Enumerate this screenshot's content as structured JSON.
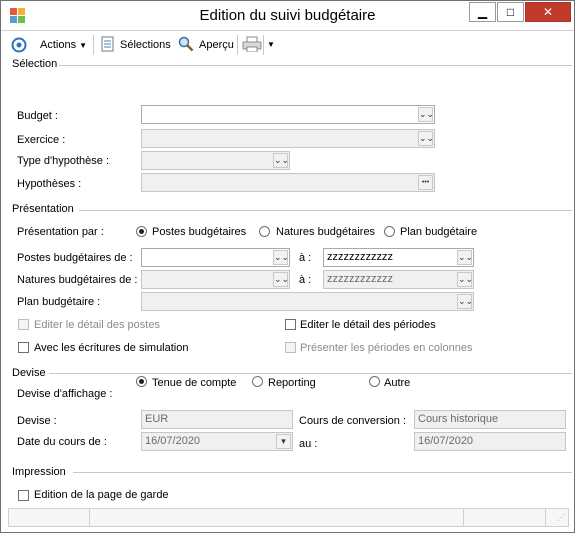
{
  "window": {
    "title": "Edition du suivi budgétaire",
    "controls": {
      "minimize": "▁",
      "maximize": "□",
      "close": "✕"
    }
  },
  "toolbar": {
    "actions_label": "Actions",
    "selections_label": "Sélections",
    "apercu_label": "Aperçu"
  },
  "selection": {
    "title": "Sélection",
    "budget": {
      "label": "Budget :",
      "value": ""
    },
    "exercice": {
      "label": "Exercice :",
      "value": ""
    },
    "type_hypothese": {
      "label": "Type d'hypothèse :",
      "value": ""
    },
    "hypotheses": {
      "label": "Hypothèses :",
      "value": "",
      "button": "•••"
    }
  },
  "presentation": {
    "title": "Présentation",
    "par_label": "Présentation par :",
    "options": [
      "Postes budgétaires",
      "Natures budgétaires",
      "Plan budgétaire"
    ],
    "selected": "Postes budgétaires",
    "postes": {
      "label": "Postes budgétaires de :",
      "from": "",
      "to_label": "à :",
      "to": "zzzzzzzzzzzz"
    },
    "natures": {
      "label": "Natures budgétaires de :",
      "from": "",
      "to_label": "à :",
      "to": "zzzzzzzzzzzz"
    },
    "plan": {
      "label": "Plan budgétaire :",
      "value": ""
    },
    "checks": {
      "detail_postes": "Editer le détail des postes",
      "detail_periodes": "Editer le détail des périodes",
      "simulation": "Avec les écritures de simulation",
      "periodes_colonnes": "Présenter les périodes en colonnes"
    }
  },
  "devise": {
    "title": "Devise",
    "affichage_label": "Devise d'affichage :",
    "options": [
      "Tenue de compte",
      "Reporting",
      "Autre"
    ],
    "selected": "Tenue de compte",
    "devise_label": "Devise :",
    "devise_value": "EUR",
    "cours_label": "Cours de conversion :",
    "cours_value": "Cours historique",
    "date_label": "Date du cours de :",
    "date_value": "16/07/2020",
    "au_label": "au :",
    "au_value": "16/07/2020"
  },
  "impression": {
    "title": "Impression",
    "page_garde": "Edition de la page de garde"
  },
  "icons": {
    "dropdown": "chevron-double-down-icon",
    "ellipsis": "ellipsis-icon",
    "actions": "circle-target-icon",
    "selections": "document-icon",
    "apercu": "magnifier-icon",
    "print": "printer-icon"
  }
}
